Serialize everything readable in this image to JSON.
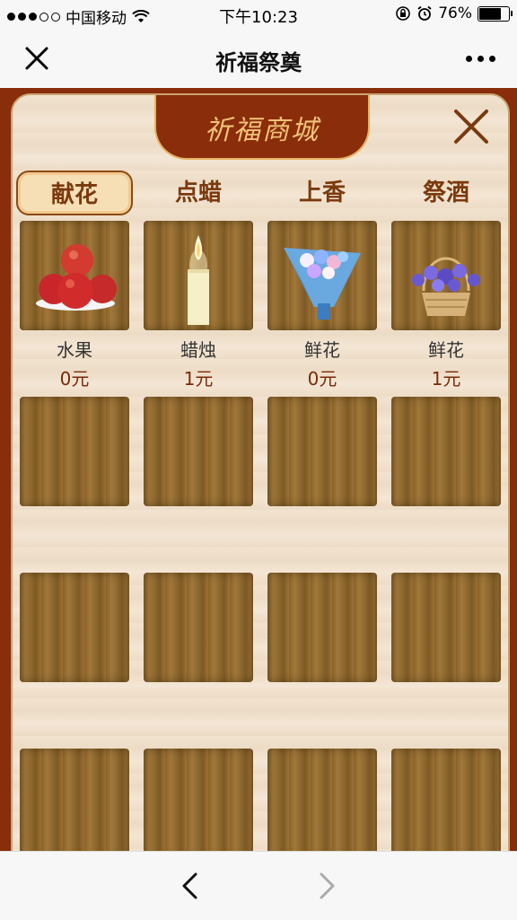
{
  "status": {
    "carrier": "中国移动",
    "time": "下午10:23",
    "battery": "76%",
    "battery_level": 0.76
  },
  "nav": {
    "title": "祈福祭奠"
  },
  "shop": {
    "banner": "祈福商城",
    "tabs": [
      {
        "label": "献花",
        "active": true
      },
      {
        "label": "点蜡",
        "active": false
      },
      {
        "label": "上香",
        "active": false
      },
      {
        "label": "祭酒",
        "active": false
      }
    ],
    "items": [
      {
        "name": "水果",
        "price": "0元",
        "icon": "apples-icon"
      },
      {
        "name": "蜡烛",
        "price": "1元",
        "icon": "candle-icon"
      },
      {
        "name": "鲜花",
        "price": "0元",
        "icon": "bouquet-icon"
      },
      {
        "name": "鲜花",
        "price": "1元",
        "icon": "flower-basket-icon"
      }
    ]
  }
}
